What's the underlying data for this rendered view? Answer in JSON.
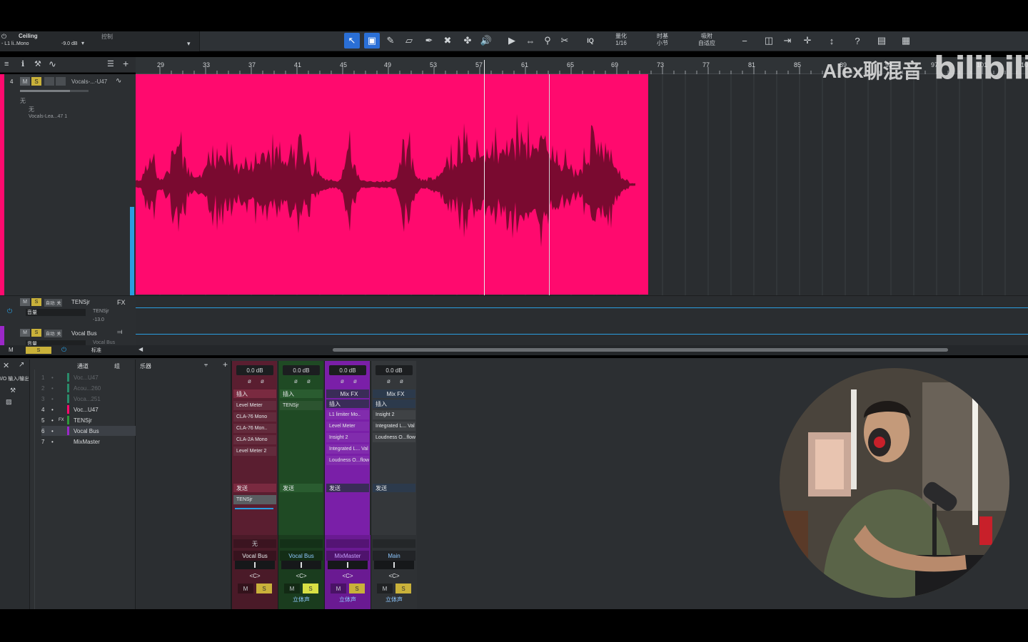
{
  "ceiling": {
    "title": "Ceiling",
    "subtitle": "- L1 li..Mono",
    "db": "-9.0 dB",
    "ctrl": "控制"
  },
  "toolbar": {
    "iq": "IQ",
    "quant_label": "量化",
    "quant_value": "1/16",
    "timebase_label": "时基",
    "timebase_value": "小节",
    "snap_label": "吸附",
    "snap_value": "自适应"
  },
  "ruler": {
    "marks": [
      "29",
      "33",
      "37",
      "41",
      "45",
      "49",
      "53",
      "57",
      "61",
      "65",
      "69",
      "73",
      "77",
      "81",
      "85",
      "89",
      "93",
      "97",
      "101",
      "10"
    ]
  },
  "track": {
    "number": "4",
    "m": "M",
    "s": "S",
    "name": "Vocals-...-U47",
    "none1": "无",
    "none2": "无",
    "input": "Vocals-Lea...47 1"
  },
  "fx_track": {
    "m": "M",
    "s": "S",
    "auto": "自动: 关",
    "name": "TENSjr",
    "fx": "FX",
    "send": "音量",
    "plugin": "TENSjr",
    "value": "-13.0"
  },
  "bus_track": {
    "m": "M",
    "s": "S",
    "auto": "自动: 关",
    "name": "Vocal Bus",
    "send": "音量",
    "sub": "Vocal Bus"
  },
  "lower_bar": {
    "m": "M",
    "s": "S",
    "std": "标准"
  },
  "mixer_tabs": {
    "io": "I/O 输入/输出",
    "channels": "通道",
    "groups": "组",
    "instruments": "乐器"
  },
  "channel_list": [
    {
      "num": "1",
      "name": "Voc...U47",
      "dim": true,
      "color": "#2a8a6a"
    },
    {
      "num": "2",
      "name": "Acou...260",
      "dim": true,
      "color": "#2a8a6a"
    },
    {
      "num": "3",
      "name": "Voca...251",
      "dim": true,
      "color": "#2a8a6a"
    },
    {
      "num": "4",
      "name": "Voc...U47",
      "dim": false,
      "color": "#ff0a6e"
    },
    {
      "num": "5",
      "name": "TENSjr",
      "dim": false,
      "color": "#2e9a3a",
      "tag": "FX"
    },
    {
      "num": "6",
      "name": "Vocal Bus",
      "dim": false,
      "color": "#9b28c8",
      "selected": true
    },
    {
      "num": "7",
      "name": "MixMaster",
      "dim": false,
      "color": ""
    }
  ],
  "strips": [
    {
      "db": "0.0 dB",
      "insert_hdr": "插入",
      "inserts": [
        "Level Meter",
        "CLA-76 Mono",
        "CLA-76 Mon..",
        "CLA-2A Mono",
        "Level Meter 2"
      ],
      "send_hdr": "发送",
      "sends": [
        "TENSjr"
      ],
      "io": "无",
      "name": "Vocal Bus",
      "pan": "<C>",
      "m": "M",
      "s": "S",
      "out": ""
    },
    {
      "db": "0.0 dB",
      "insert_hdr": "插入",
      "inserts": [
        "TENSjr"
      ],
      "send_hdr": "发送",
      "sends": [],
      "io": "",
      "name": "Vocal Bus",
      "pan": "<C>",
      "m": "M",
      "s": "S",
      "out": "立体声"
    },
    {
      "db": "0.0 dB",
      "mixfx": "Mix FX",
      "insert_hdr": "插入",
      "inserts": [
        "L1 limiter Mo..",
        "Level Meter",
        "Insight 2",
        "Integrated L... Val",
        "Loudness O...flow"
      ],
      "send_hdr": "发送",
      "sends": [],
      "io": "",
      "name": "MixMaster",
      "pan": "<C>",
      "m": "M",
      "s": "S",
      "out": "立体声"
    },
    {
      "db": "0.0 dB",
      "mixfx": "Mix FX",
      "insert_hdr": "插入",
      "inserts": [
        "Insight 2",
        "Integrated L... Val",
        "Loudness O...flow"
      ],
      "send_hdr": "发送",
      "sends": [],
      "io": "",
      "name": "Main",
      "pan": "<C>",
      "m": "M",
      "s": "S",
      "out": "立体声"
    }
  ],
  "watermark": {
    "text": "Alex聊混音",
    "brand": "bilibili"
  },
  "colors": {
    "clip": "#ff0a6e",
    "accent": "#2a6fd6",
    "green_strip": "#1f4a24",
    "purple_strip": "#7a1fa8",
    "red_strip": "#5a1e30"
  }
}
